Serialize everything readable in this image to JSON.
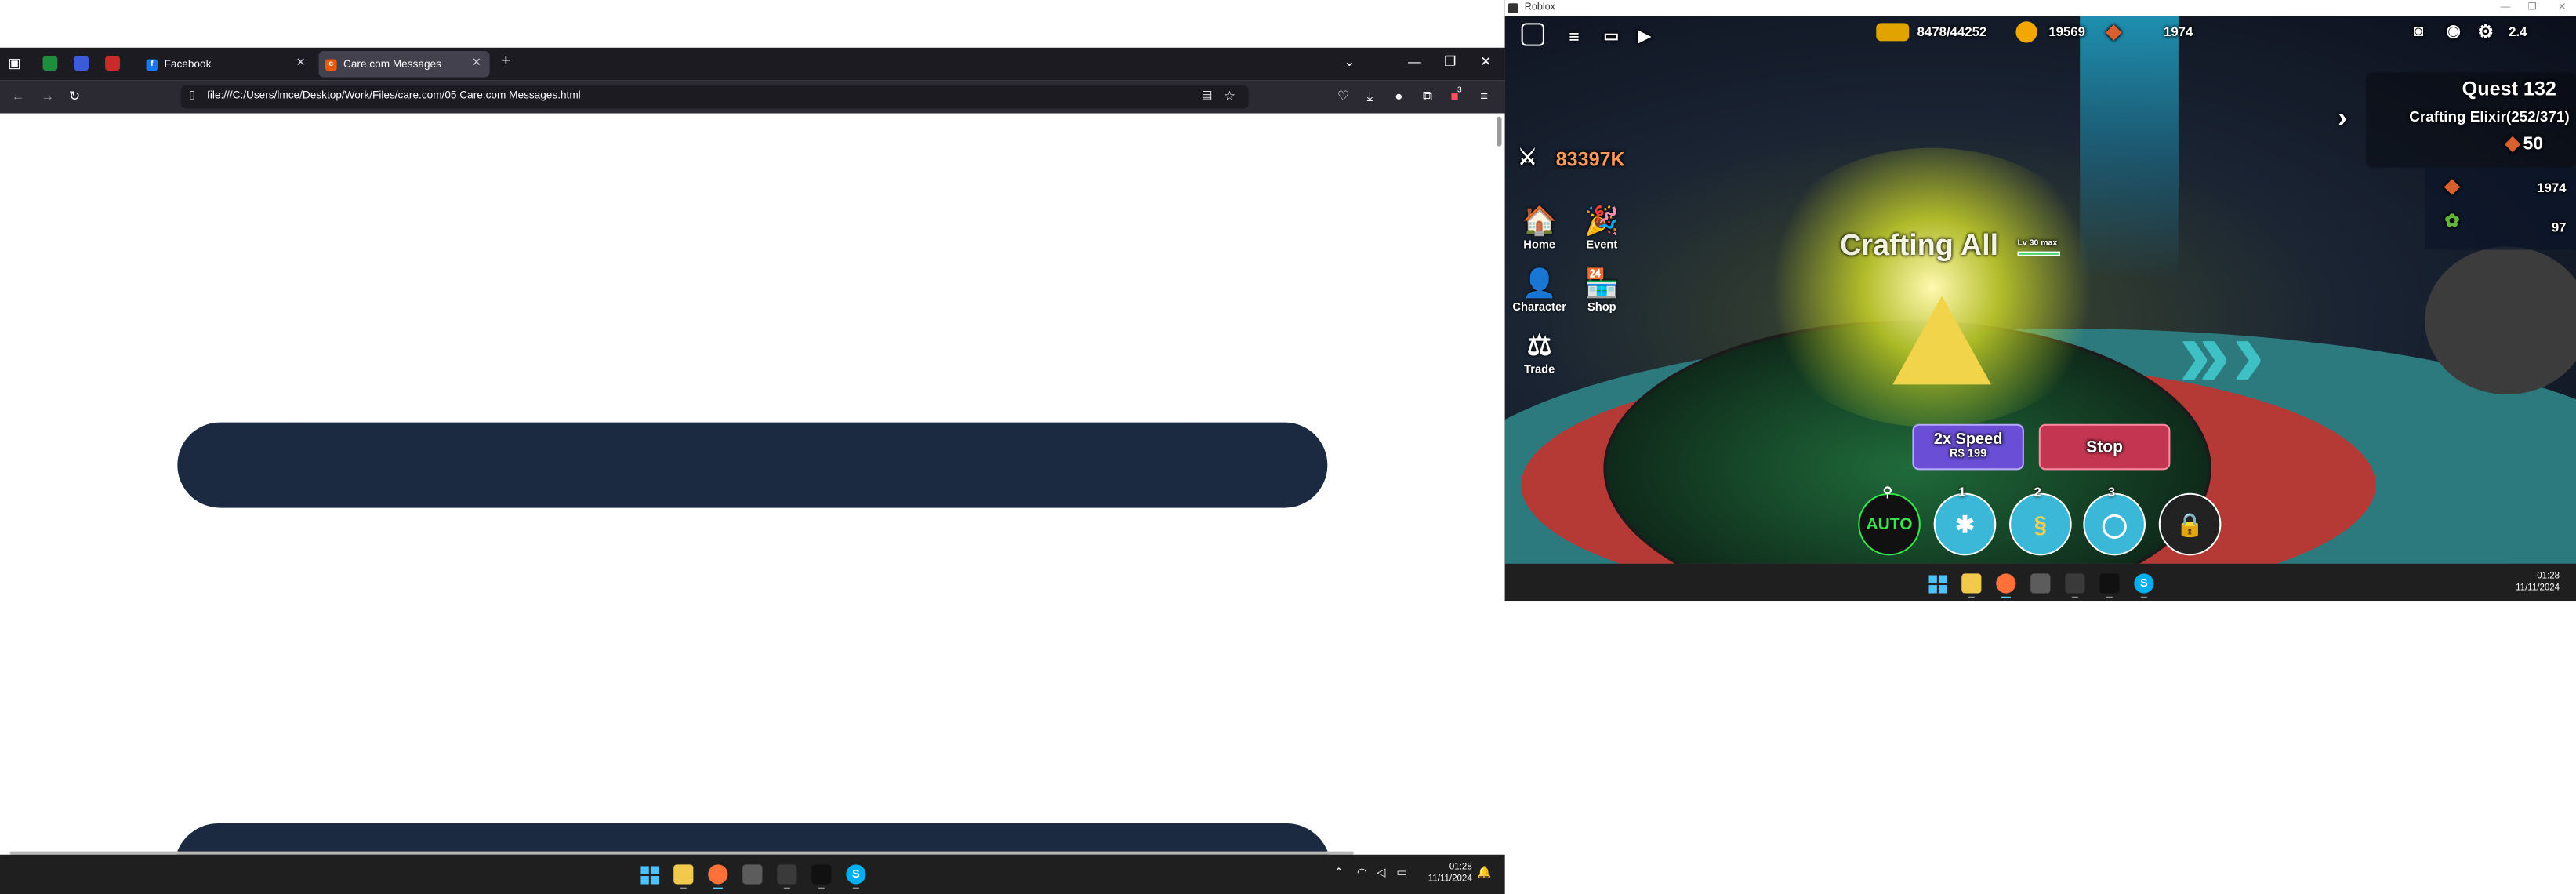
{
  "firefox": {
    "tabs": [
      {
        "label": "Facebook",
        "favicon": "facebook-icon"
      },
      {
        "label": "Care.com Messages",
        "favicon": "care-icon"
      }
    ],
    "pinned_tabs": [
      "sheets-icon",
      "x-icon",
      "gmail-icon"
    ],
    "new_tab_label": "+",
    "window_controls": {
      "minimize": "—",
      "maximize": "❐",
      "close": "✕"
    },
    "url": "file:///C:/Users/lmce/Desktop/Work/Files/care.com/05 Care.com Messages.html",
    "extension_badge": "3",
    "taskbar": {
      "time": "01:28",
      "date": "11/11/2024"
    }
  },
  "roblox": {
    "window_title": "Roblox",
    "stats": {
      "xp": "8478/44252",
      "coins": "19569",
      "gems": "1974",
      "level": "2.4"
    },
    "power": "83397K",
    "nav": [
      {
        "label": "Home",
        "icon": "home-icon",
        "glyph": "🏠"
      },
      {
        "label": "Event",
        "icon": "party-hat-icon",
        "glyph": "🎉"
      },
      {
        "label": "Character",
        "icon": "character-icon",
        "glyph": "👤"
      },
      {
        "label": "Shop",
        "icon": "shop-icon",
        "glyph": "🏪"
      },
      {
        "label": "Trade",
        "icon": "scale-icon",
        "glyph": "⚖"
      }
    ],
    "quest": {
      "title": "Quest 132",
      "task": "Crafting Elixir(252/371)",
      "reward": "50"
    },
    "resources": [
      {
        "value": "1974",
        "icon": "gem-icon"
      },
      {
        "value": "97",
        "icon": "plant-icon"
      }
    ],
    "floating_text": "Crafting All",
    "tag_text": "Lv 30 max",
    "speed_button": {
      "label": "2x Speed",
      "price": "R$ 199"
    },
    "stop_button": "Stop",
    "auto_label": "AUTO",
    "skills": [
      "1",
      "2",
      "3"
    ],
    "taskbar": {
      "time": "01:28",
      "date": "11/11/2024"
    }
  }
}
